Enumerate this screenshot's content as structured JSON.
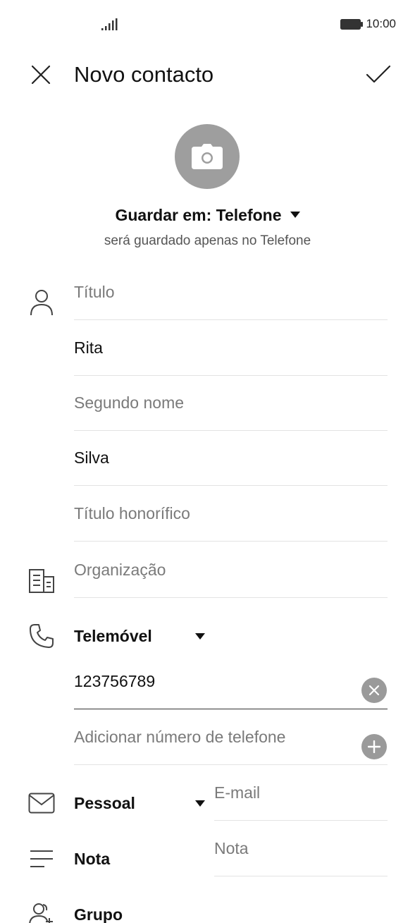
{
  "status_bar": {
    "time": "10:00"
  },
  "header": {
    "title": "Novo contacto"
  },
  "storage": {
    "label": "Guardar em: Telefone",
    "subtitle": "será guardado apenas no Telefone"
  },
  "name_fields": {
    "title_placeholder": "Título",
    "first_name_value": "Rita",
    "middle_name_placeholder": "Segundo nome",
    "last_name_value": "Silva",
    "honorific_placeholder": "Título honorífico"
  },
  "organization": {
    "placeholder": "Organização"
  },
  "phone": {
    "type_label": "Telemóvel",
    "number_value": "123756789",
    "add_placeholder": "Adicionar número de telefone"
  },
  "email": {
    "type_label": "Pessoal",
    "placeholder": "E-mail"
  },
  "note": {
    "label": "Nota",
    "placeholder": "Nota"
  },
  "group": {
    "label": "Grupo"
  },
  "icons": {
    "close": "close-icon",
    "confirm": "check-icon",
    "camera": "camera-icon",
    "person": "person-icon",
    "organization": "building-icon",
    "phone": "phone-icon",
    "email": "envelope-icon",
    "note": "note-lines-icon",
    "group": "group-add-icon",
    "clear": "clear-icon",
    "add": "add-icon"
  }
}
